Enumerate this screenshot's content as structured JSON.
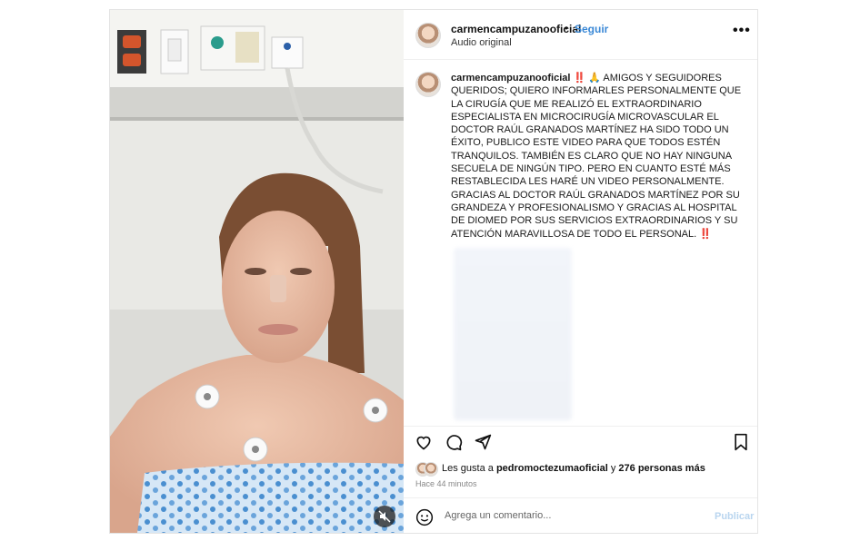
{
  "header": {
    "username": "carmencampuzanooficial",
    "separator": "•",
    "follow_label": "Seguir",
    "audio_label": "Audio original",
    "more_icon": "more-options-icon"
  },
  "caption": {
    "username": "carmencampuzanooficial",
    "emoji_marks": "‼️",
    "prayer_emoji": "🙏",
    "text": "AMIGOS Y SEGUIDORES QUERIDOS; QUIERO INFORMARLES PERSONALMENTE QUE LA CIRUGÍA QUE ME REALIZÓ EL EXTRAORDINARIO ESPECIALISTA EN MICROCIRUGÍA MICROVASCULAR EL DOCTOR RAÚL GRANADOS MARTÍNEZ HA SIDO TODO UN ÉXITO, PUBLICO ESTE VIDEO PARA QUE TODOS ESTÉN TRANQUILOS. TAMBIÉN ES CLARO QUE NO HAY NINGUNA SECUELA DE NINGÚN TIPO. PERO EN CUANTO ESTÉ MÁS RESTABLECIDA LES HARÉ UN VIDEO PERSONALMENTE. GRACIAS AL DOCTOR RAÚL GRANADOS MARTÍNEZ POR SU GRANDEZA Y PROFESIONALISMO Y GRACIAS AL HOSPITAL DE DIOMED POR SUS SERVICIOS EXTRAORDINARIOS Y SU ATENCIÓN MARAVILLOSA DE TODO EL PERSONAL.",
    "end_marks": "‼️"
  },
  "actions": {
    "like_icon": "heart-icon",
    "comment_icon": "comment-icon",
    "share_icon": "send-icon",
    "save_icon": "bookmark-icon"
  },
  "likes": {
    "prefix": "Les gusta a",
    "user": "pedromoctezumaoficial",
    "connector": "y",
    "others": "276 personas más"
  },
  "time": "Hace 44 minutos",
  "comment": {
    "emoji_icon": "smiley-icon",
    "placeholder": "Agrega un comentario...",
    "publish_label": "Publicar"
  },
  "media": {
    "description_icon": "mute-icon",
    "colors": {
      "gown": "#cfe3f4",
      "gown_pattern": "#4a8fd0",
      "wall": "#ecece8"
    }
  }
}
